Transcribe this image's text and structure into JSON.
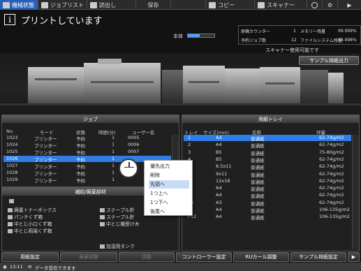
{
  "tabs": [
    {
      "label": "機械状態",
      "active": true
    },
    {
      "label": "ジョブリスト",
      "active": false
    },
    {
      "label": "読出し",
      "active": false
    },
    {
      "label": "保存",
      "active": false
    },
    {
      "label": "コピー",
      "active": false
    },
    {
      "label": "スキャナー",
      "active": false
    }
  ],
  "header": {
    "title": "プリントしています",
    "body_label": "本体",
    "body_progress": 0.45,
    "scanner_message": "スキャナー使用可能です",
    "stats": {
      "orig_counter_label": "原稿カウンター",
      "orig_counter_value": "1",
      "memory_label": "メモリー残量",
      "memory_value": "99.999%",
      "reserved_jobs_label": "予約ジョブ数",
      "reserved_jobs_value": "12",
      "filesys_label": "ファイルシステム残量",
      "filesys_value": "99.998%"
    }
  },
  "sample_button": "サンプル排紙出力",
  "job_panel": {
    "title": "ジョブ",
    "columns": [
      "No.",
      "モード",
      "状態",
      "時間(分)",
      "ユーザー名"
    ],
    "rows": [
      {
        "no": "1023",
        "mode": "プリンター",
        "state": "予約",
        "time": "1",
        "user": "0005",
        "selected": false,
        "ghost": false
      },
      {
        "no": "1024",
        "mode": "プリンター",
        "state": "予約",
        "time": "1",
        "user": "0006",
        "selected": false,
        "ghost": false
      },
      {
        "no": "1025",
        "mode": "プリンター",
        "state": "予約",
        "time": "1",
        "user": "0007",
        "selected": false,
        "ghost": false
      },
      {
        "no": "1026",
        "mode": "プリンター",
        "state": "予約",
        "time": "1",
        "user": "",
        "selected": true,
        "ghost": false
      },
      {
        "no": "1027",
        "mode": "プリンター",
        "state": "予約",
        "time": "1",
        "user": "",
        "selected": false,
        "ghost": false
      },
      {
        "no": "1028",
        "mode": "プリンター",
        "state": "予約",
        "time": "1",
        "user": "",
        "selected": false,
        "ghost": false
      },
      {
        "no": "1029",
        "mode": "プリンター",
        "state": "予約",
        "time": "1",
        "user": "",
        "selected": false,
        "ghost": false
      }
    ]
  },
  "context_menu": {
    "items": [
      {
        "label": "優先出力",
        "highlight": false
      },
      {
        "label": "削除",
        "highlight": false
      },
      {
        "label": "先頭へ",
        "highlight": true
      },
      {
        "label": "1つ上へ",
        "highlight": false
      },
      {
        "label": "1つ下へ",
        "highlight": false
      },
      {
        "label": "後尾へ",
        "highlight": false
      }
    ]
  },
  "tray_panel": {
    "title": "用紙トレイ",
    "columns": [
      "トレイ",
      "サイズ(mm)",
      "名称",
      "坪量"
    ],
    "rows": [
      {
        "tray": "1",
        "size": "A4",
        "name": "普通紙",
        "weight": "62-74g/m2",
        "selected": true
      },
      {
        "tray": "2",
        "size": "A4",
        "name": "普通紙",
        "weight": "62-74g/m2",
        "selected": false
      },
      {
        "tray": "3",
        "size": "B5",
        "name": "普通紙",
        "weight": "75-80g/m2",
        "selected": false
      },
      {
        "tray": "4",
        "size": "B5",
        "name": "普通紙",
        "weight": "62-74g/m2",
        "selected": false
      },
      {
        "tray": "5",
        "size": "8.5x11",
        "name": "普通紙",
        "weight": "62-74g/m2",
        "selected": false
      },
      {
        "tray": "6",
        "size": "9x11",
        "name": "普通紙",
        "weight": "62-74g/m2",
        "selected": false
      },
      {
        "tray": "7",
        "size": "12x18",
        "name": "普通紙",
        "weight": "62-74g/m2",
        "selected": false
      },
      {
        "tray": "8",
        "size": "A4",
        "name": "普通紙",
        "weight": "62-74g/m2",
        "selected": false
      },
      {
        "tray": "9",
        "size": "A4",
        "name": "普通紙",
        "weight": "62-74g/m2",
        "selected": false
      },
      {
        "tray": "10",
        "size": "A3",
        "name": "普通紙",
        "weight": "62-74g/m2",
        "selected": false
      },
      {
        "tray": "11",
        "size": "A4",
        "name": "普通紙",
        "weight": "106-135g/m2",
        "selected": false
      },
      {
        "tray": "P12",
        "size": "A4",
        "name": "普通紙",
        "weight": "106-135g/m2",
        "selected": false
      }
    ]
  },
  "supplies_panel": {
    "title": "補給/廃棄部材",
    "left_items": [
      "廃棄トナーボックス",
      "パンチくず箱",
      "中とじ小口くず箱",
      "中とじ両端くず箱"
    ],
    "right_items": [
      "ステープル針",
      "ステープル針",
      "中とじ機受け木"
    ],
    "bottom_item": "加湿用タンク"
  },
  "bottom_buttons": [
    {
      "label": "用紙設定",
      "dim": false
    },
    {
      "label": "表裏調整",
      "dim": true
    },
    {
      "label": "調整",
      "dim": true
    },
    {
      "label": "コントローラー設定",
      "dim": false
    },
    {
      "label": "RUカール調整",
      "dim": false
    },
    {
      "label": "サンプル排紙設定",
      "dim": false
    }
  ],
  "status_bar": {
    "time": "13:11",
    "message": "データ受信できます"
  },
  "icons": {
    "info": "info-icon",
    "mouse": "mouse-icon",
    "settings": "gear-icon",
    "network": "globe-icon"
  }
}
